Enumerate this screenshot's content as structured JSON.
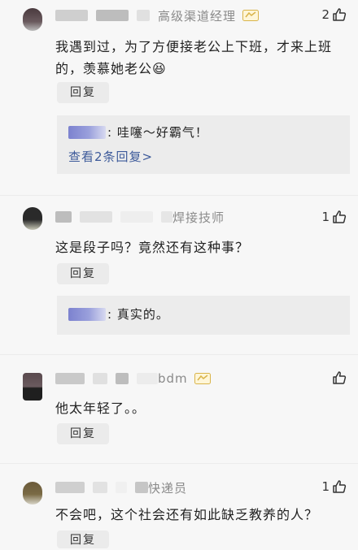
{
  "comments": [
    {
      "title": "高级渠道经理",
      "likes": "2",
      "text": "我遇到过，为了方便接老公上下班，才来上班的，羡慕她老公",
      "emoji": "😆",
      "reply_label": "回复",
      "reply_preview": ": 哇噻～好霸气！",
      "view_more": "查看2条回复>"
    },
    {
      "title": "焊接技师",
      "likes": "1",
      "text": "这是段子吗？竟然还有这种事？",
      "reply_label": "回复",
      "reply_preview": ": 真实的。"
    },
    {
      "title": "bdm",
      "likes": "",
      "text": "他太年轻了。。",
      "reply_label": "回复"
    },
    {
      "title": "快递员",
      "likes": "1",
      "text": "不会吧，这个社会还有如此缺乏教养的人？",
      "reply_label": "回复"
    }
  ],
  "icons": {
    "like": "thumbs-up-icon",
    "badge": "verified-badge-icon"
  },
  "colors": {
    "background": "#f7f7f7",
    "reply_box": "#ececec",
    "link": "#3d5a9a",
    "badge": "#d9b44a"
  }
}
